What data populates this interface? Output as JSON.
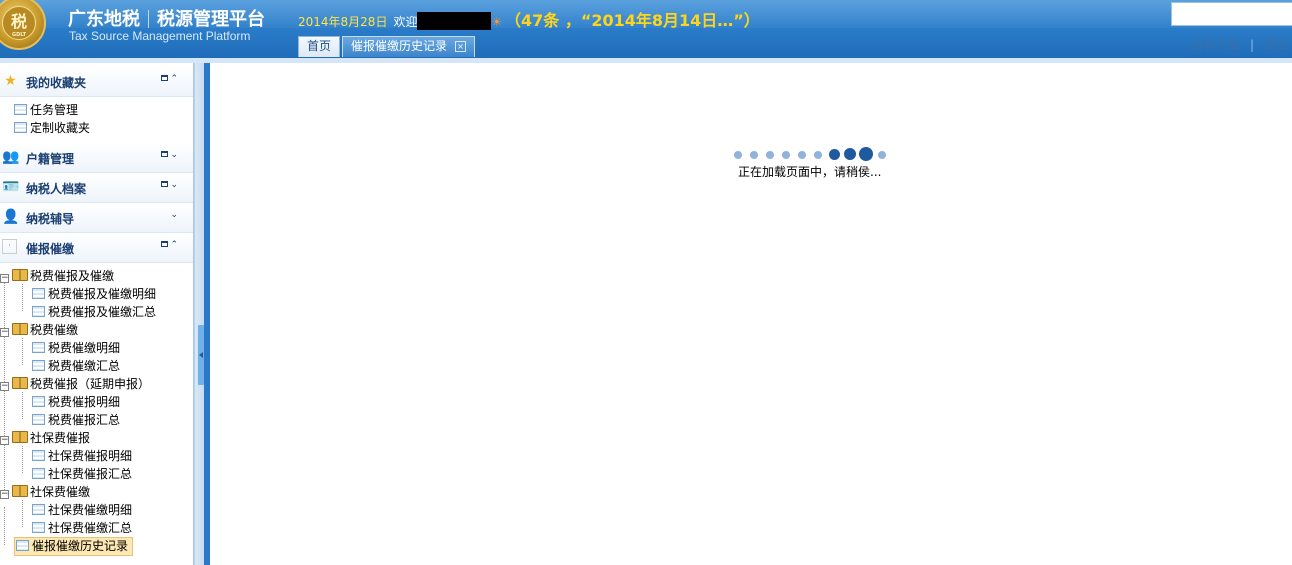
{
  "header": {
    "logo_text": "税",
    "logo_subtext": "GDLT",
    "title_part1": "广东地税",
    "title_part2": "税源管理平台",
    "subtitle": "Tax Source Management Platform",
    "date": "2014年8月28日",
    "welcome_label": "欢迎",
    "welcome_tail": "☀",
    "notice": "（47条 ，“2014年8月14日…”）",
    "links": {
      "download": "资料下载",
      "separator": "|",
      "logout": "退出"
    }
  },
  "tabs": [
    {
      "label": "首页"
    },
    {
      "label": "催报催缴历史记录",
      "close": "×"
    }
  ],
  "sidebar": {
    "favorites": {
      "title": "我的收藏夹",
      "items": [
        {
          "label": "任务管理"
        },
        {
          "label": "定制收藏夹"
        }
      ]
    },
    "sections": [
      {
        "title": "户籍管理"
      },
      {
        "title": "纳税人档案"
      },
      {
        "title": "纳税辅导"
      },
      {
        "title": "催报催缴"
      }
    ],
    "tree": [
      {
        "label": "税费催报及催缴",
        "children": [
          "税费催报及催缴明细",
          "税费催报及催缴汇总"
        ]
      },
      {
        "label": "税费催缴",
        "children": [
          "税费催缴明细",
          "税费催缴汇总"
        ]
      },
      {
        "label": "税费催报（延期申报）",
        "children": [
          "税费催报明细",
          "税费催报汇总"
        ]
      },
      {
        "label": "社保费催报",
        "children": [
          "社保费催报明细",
          "社保费催报汇总"
        ]
      },
      {
        "label": "社保费催缴",
        "children": [
          "社保费催缴明细",
          "社保费催缴汇总"
        ]
      }
    ],
    "history_item": "催报催缴历史记录"
  },
  "main": {
    "loading_text": "正在加载页面中，请稍侯..."
  },
  "colors": {
    "header_blue": "#2a7cc8",
    "accent_yellow": "#ffd51a",
    "loader_dark": "#1f5a9e",
    "loader_light": "#8fb3da"
  }
}
